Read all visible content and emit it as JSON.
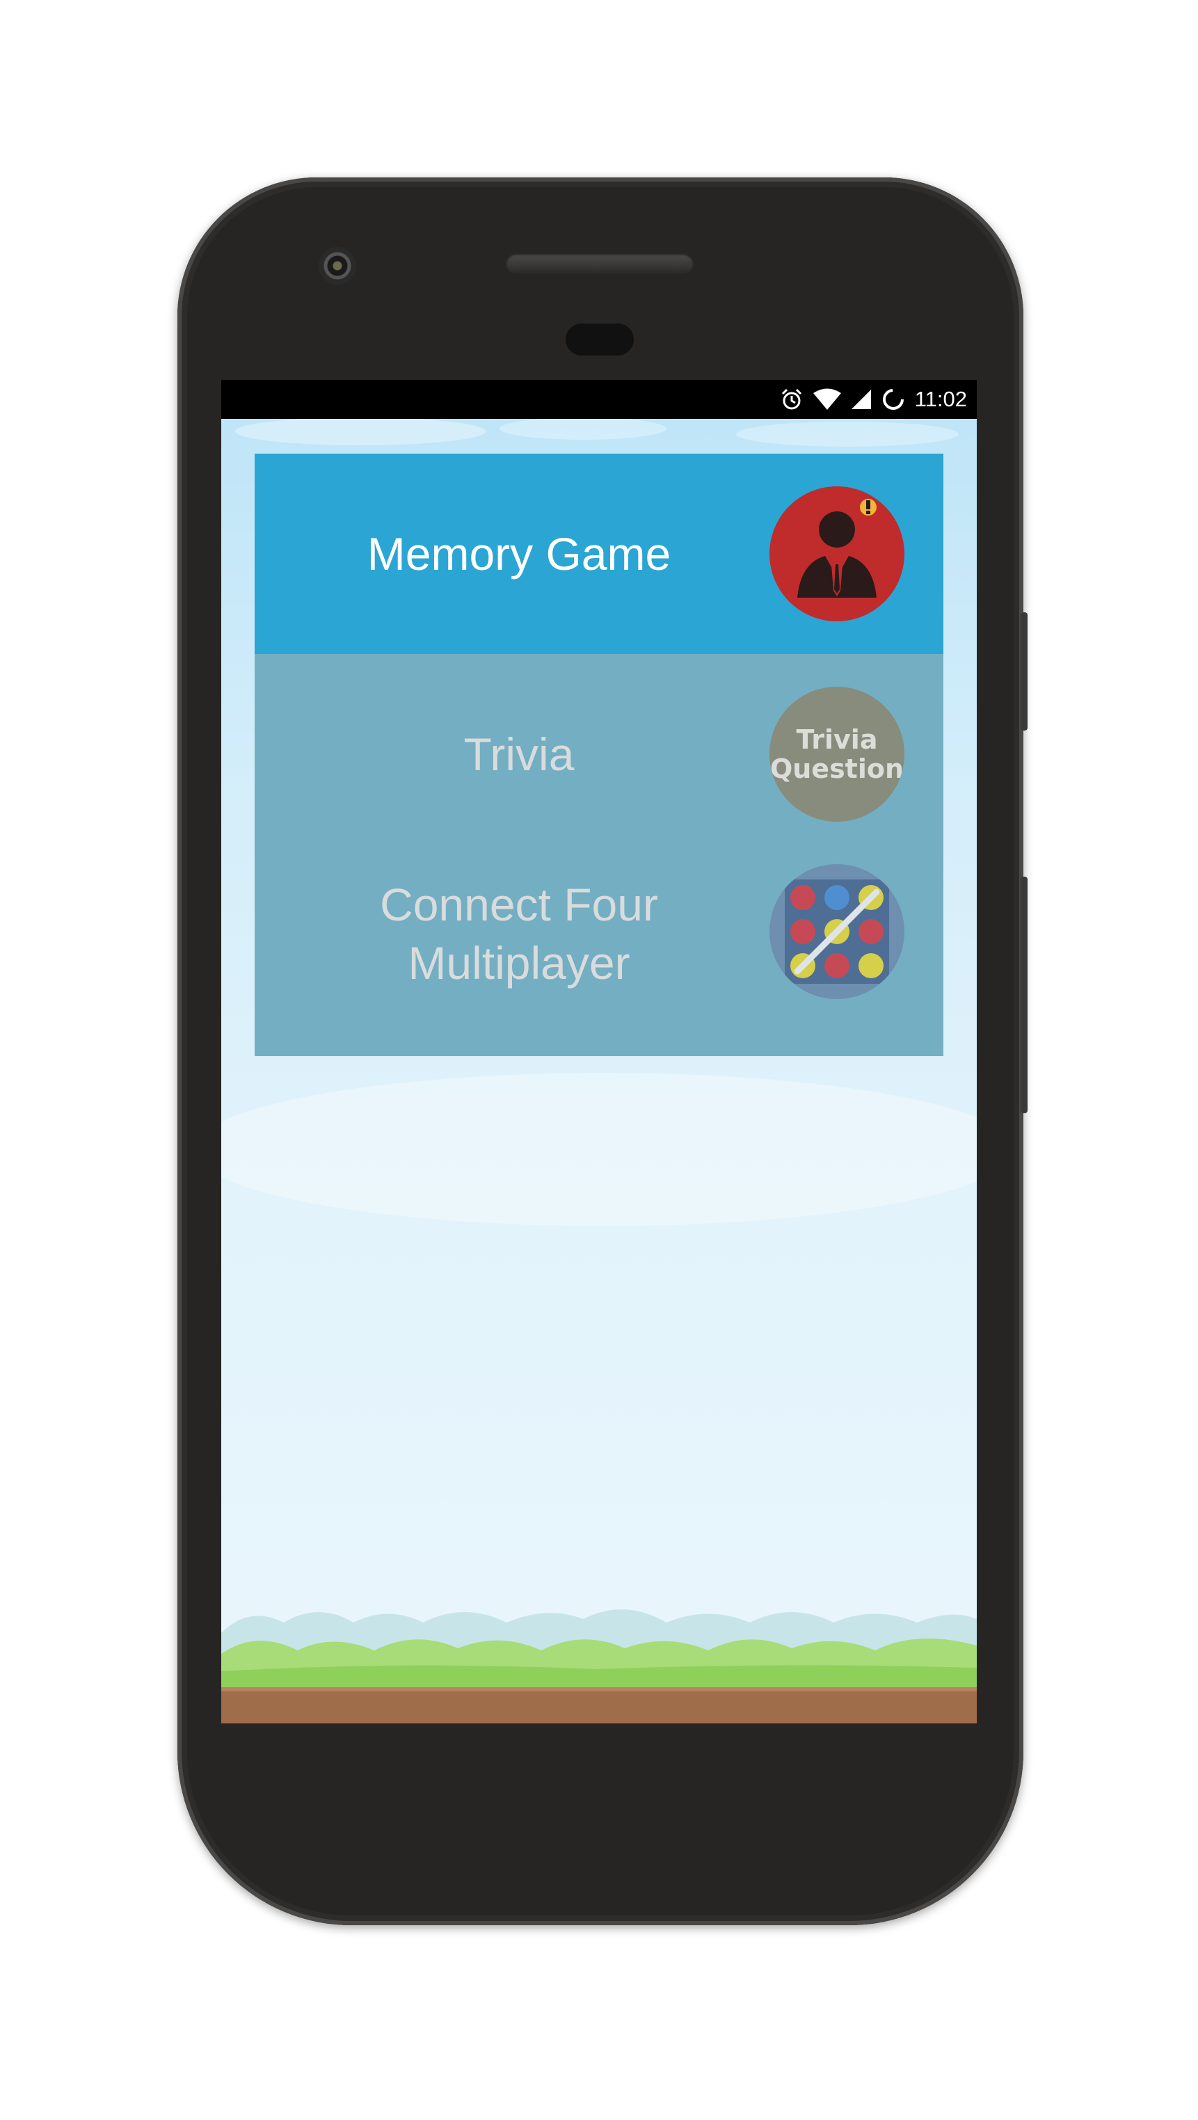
{
  "status_bar": {
    "time": "11:02",
    "icons": [
      "alarm-icon",
      "wifi-icon",
      "cell-signal-icon",
      "battery-icon"
    ]
  },
  "menu": {
    "items": [
      {
        "line1": "Memory Game",
        "line2": "",
        "icon": "memory-game-icon",
        "active": true
      },
      {
        "line1": "Trivia",
        "line2": "",
        "icon": "trivia-question-icon",
        "icon_text_1": "Trivia",
        "icon_text_2": "Question",
        "active": false
      },
      {
        "line1": "Connect Four",
        "line2": "Multiplayer",
        "icon": "connect-four-icon",
        "active": false
      }
    ]
  },
  "colors": {
    "active_item": "#2ba5d3",
    "menu_background": "#74aec2",
    "memory_icon": "#c02b2c",
    "trivia_icon": "#878c7d",
    "connect_four_icon": "#6f8fb0",
    "grass": "#9ed868",
    "dirt": "#a06d4a"
  }
}
